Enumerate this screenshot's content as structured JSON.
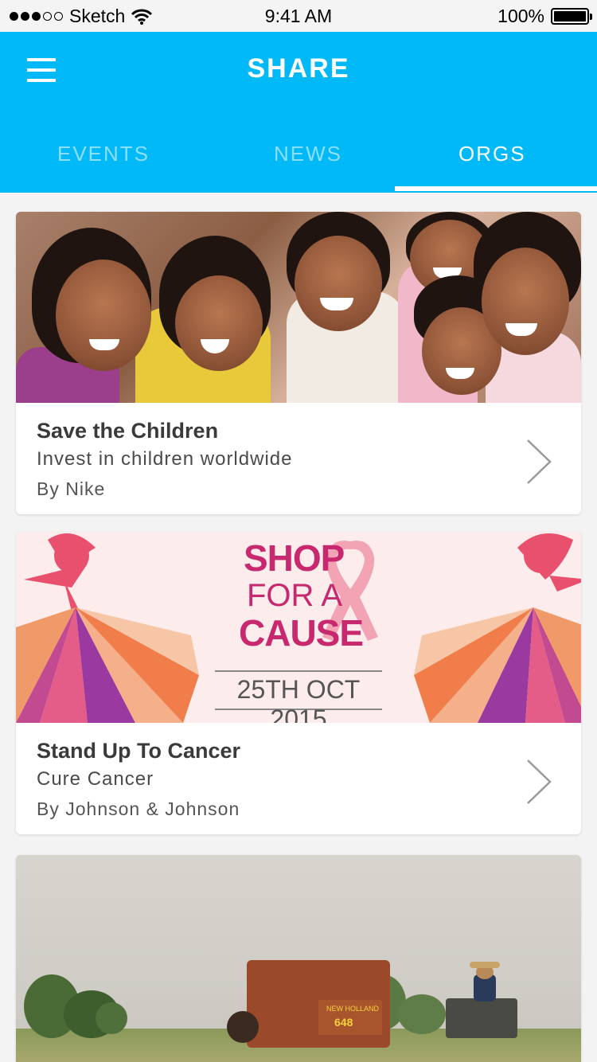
{
  "status_bar": {
    "carrier": "Sketch",
    "time": "9:41 AM",
    "battery": "100%"
  },
  "app": {
    "title": "SHARE"
  },
  "tabs": [
    {
      "label": "EVENTS"
    },
    {
      "label": "NEWS"
    },
    {
      "label": "ORGS"
    }
  ],
  "active_tab": "ORGS",
  "cards": [
    {
      "title": "Save the Children",
      "subtitle": "Invest in children worldwide",
      "byline": "By Nike",
      "image": "smiling-children-photo"
    },
    {
      "title": "Stand Up To Cancer",
      "subtitle": "Cure Cancer",
      "byline": "By Johnson & Johnson",
      "image": "shop-for-a-cause-banner",
      "banner": {
        "line1": "SHOP",
        "line2": "FOR A",
        "line3": "CAUSE",
        "date": "25TH OCT 2015"
      }
    },
    {
      "image": "farm-tractor-photo",
      "machine_brand": "NEW HOLLAND",
      "machine_model": "648"
    }
  ],
  "colors": {
    "primary": "#00b9f6",
    "card_title": "#3a3a3a",
    "banner_pink": "#c8286e"
  },
  "icons": [
    "hamburger-menu-icon",
    "wifi-icon",
    "battery-icon",
    "chevron-right-icon"
  ]
}
